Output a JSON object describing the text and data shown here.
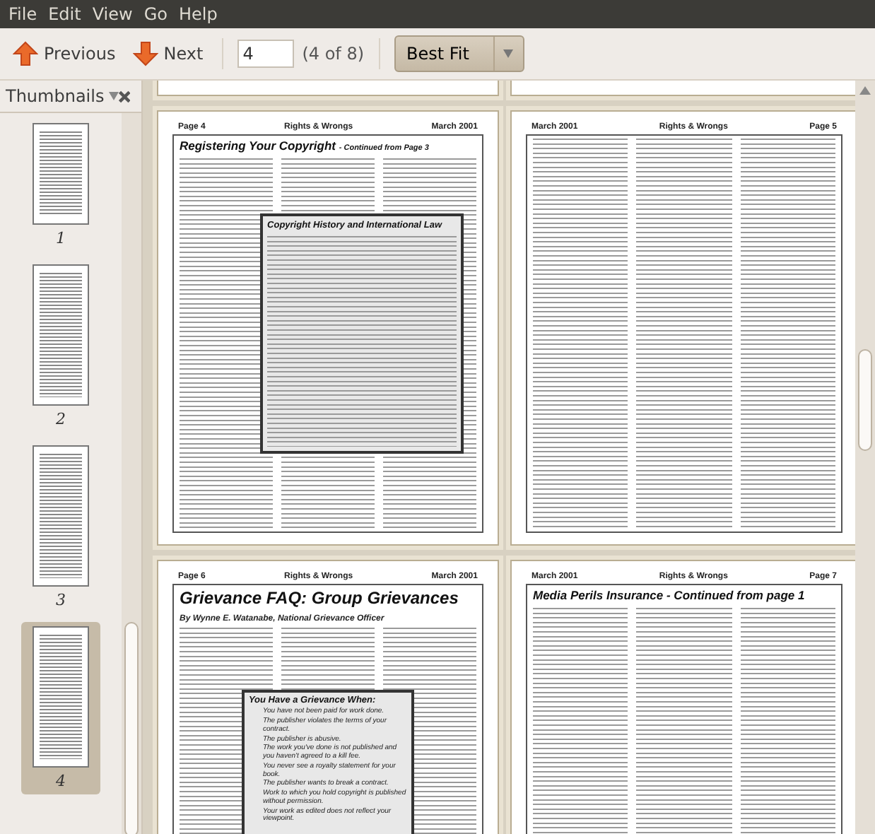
{
  "menu": [
    "File",
    "Edit",
    "View",
    "Go",
    "Help"
  ],
  "toolbar": {
    "previous": "Previous",
    "next": "Next",
    "page_entry": "4",
    "page_count": "(4 of 8)",
    "zoom": "Best Fit"
  },
  "sidebar": {
    "title": "Thumbnails",
    "thumbnails": [
      {
        "label": "1",
        "selected": false
      },
      {
        "label": "2",
        "selected": false
      },
      {
        "label": "3",
        "selected": false
      },
      {
        "label": "4",
        "selected": true
      }
    ]
  },
  "pages": [
    {
      "header": [
        "Page 4",
        "Rights & Wrongs",
        "March 2001"
      ],
      "title": "Registering Your Copyright",
      "title_suffix": "- Continued from Page 3",
      "sidebox": {
        "title": "Copyright History and International Law"
      }
    },
    {
      "header": [
        "March 2001",
        "Rights & Wrongs",
        "Page 5"
      ]
    },
    {
      "header": [
        "Page 6",
        "Rights & Wrongs",
        "March 2001"
      ],
      "title": "Grievance FAQ: Group Grievances",
      "byline": "By Wynne E. Watanabe, National Grievance Officer",
      "sidebox": {
        "title": "You Have a Grievance When:",
        "items": [
          "You have not been paid for work done.",
          "The publisher violates the terms of your contract.",
          "The publisher is abusive.",
          "The work you've done is not published and you haven't agreed to a kill fee.",
          "You never see a royalty statement for your book.",
          "The publisher wants to break a contract.",
          "Work to which you hold copyright is published without permission.",
          "Your work as edited does not reflect your viewpoint."
        ]
      }
    },
    {
      "header": [
        "March 2001",
        "Rights & Wrongs",
        "Page 7"
      ],
      "title": "Media Perils Insurance - Continued from page 1"
    }
  ]
}
